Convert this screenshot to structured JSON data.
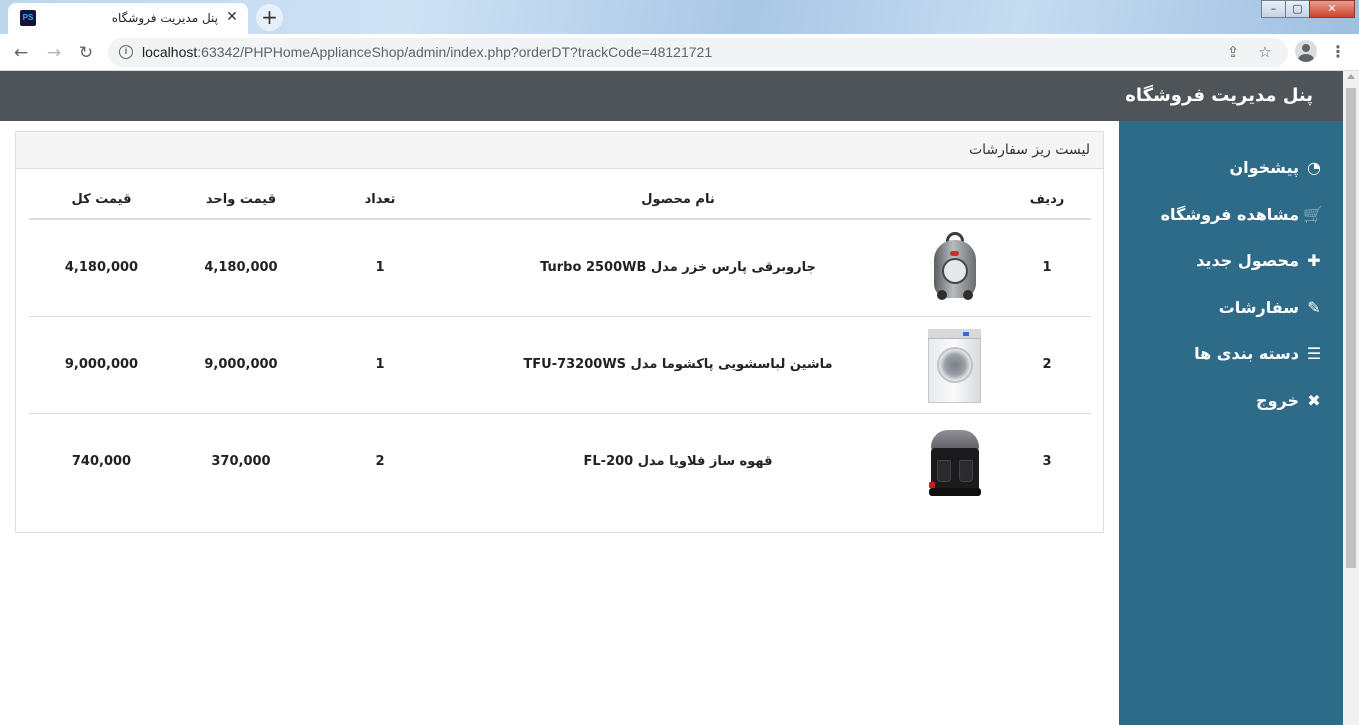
{
  "browser": {
    "tab_title": "پنل مدیریت فروشگاه",
    "favicon_text": "PS",
    "tab_close": "✕",
    "new_tab": "+",
    "url_host": "localhost",
    "url_rest": ":63342/PHPHomeApplianceShop/admin/index.php?orderDT?trackCode=48121721",
    "back": "←",
    "forward": "→",
    "reload": "↻",
    "info": "i",
    "share": "⇪",
    "star": "☆",
    "menu": "⋮",
    "win_min": "–",
    "win_max": "▢",
    "win_close": "✕"
  },
  "header": {
    "title": "پنل مدیریت فروشگاه"
  },
  "sidebar": {
    "items": [
      {
        "label": "پیشخوان",
        "icon": "dashboard-icon",
        "glyph": "◔"
      },
      {
        "label": "مشاهده فروشگاه",
        "icon": "cart-icon",
        "glyph": "🛒"
      },
      {
        "label": "محصول جدید",
        "icon": "plus-icon",
        "glyph": "✚"
      },
      {
        "label": "سفارشات",
        "icon": "pencil-icon",
        "glyph": "✎"
      },
      {
        "label": "دسته بندی ها",
        "icon": "list-icon",
        "glyph": "☰"
      },
      {
        "label": "خروج",
        "icon": "close-icon",
        "glyph": "✖"
      }
    ]
  },
  "panel": {
    "heading": "لیست ریز سفارشات",
    "columns": {
      "row": "ردیف",
      "name": "نام محصول",
      "qty": "تعداد",
      "unit": "قیمت واحد",
      "total": "قیمت کل"
    },
    "rows": [
      {
        "row": "1",
        "image": "vacuum-cleaner-image",
        "name": "جاروبرقی پارس خزر مدل Turbo 2500WB",
        "qty": "1",
        "unit": "4,180,000",
        "total": "4,180,000"
      },
      {
        "row": "2",
        "image": "washing-machine-image",
        "name": "ماشین لباسشویی پاکشوما مدل TFU-73200WS",
        "qty": "1",
        "unit": "9,000,000",
        "total": "9,000,000"
      },
      {
        "row": "3",
        "image": "coffee-maker-image",
        "name": "قهوه ساز فلاویا مدل FL-200",
        "qty": "2",
        "unit": "370,000",
        "total": "740,000"
      }
    ]
  }
}
